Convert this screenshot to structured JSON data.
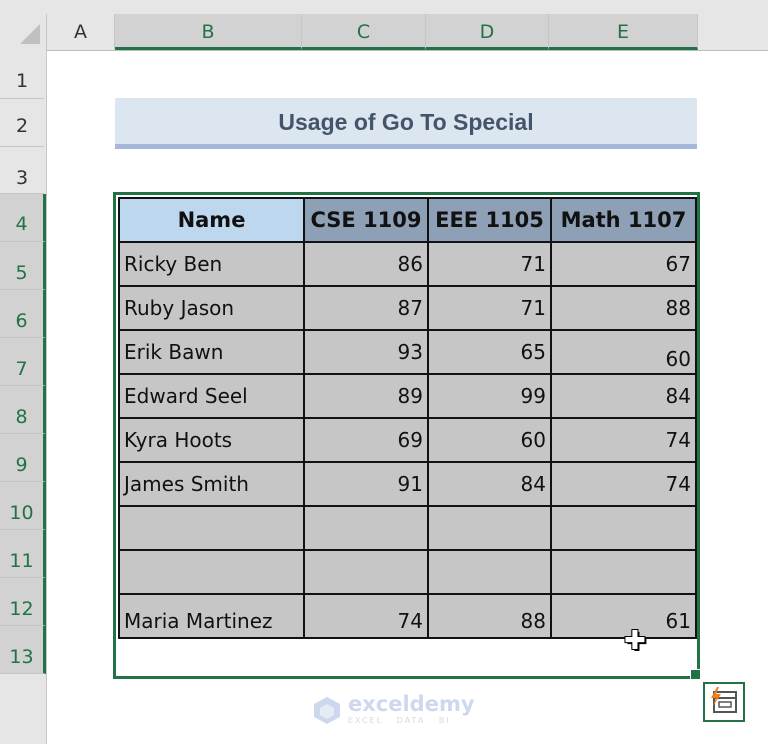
{
  "sheet": {
    "columns": [
      "A",
      "B",
      "C",
      "D",
      "E"
    ],
    "selected_columns": [
      "B",
      "C",
      "D",
      "E"
    ],
    "rows": [
      "1",
      "2",
      "3",
      "4",
      "5",
      "6",
      "7",
      "8",
      "9",
      "10",
      "11",
      "12",
      "13"
    ],
    "selected_rows": [
      "4",
      "5",
      "6",
      "7",
      "8",
      "9",
      "10",
      "11",
      "12",
      "13"
    ]
  },
  "title": "Usage of Go To Special",
  "table": {
    "headers": [
      "Name",
      "CSE 1109",
      "EEE 1105",
      "Math 1107"
    ],
    "rows": [
      [
        "Ricky Ben",
        "86",
        "71",
        "67"
      ],
      [
        "Ruby Jason",
        "87",
        "71",
        "88"
      ],
      [
        "Erik Bawn",
        "93",
        "65",
        "60"
      ],
      [
        "Edward Seel",
        "89",
        "99",
        "84"
      ],
      [
        "Kyra Hoots",
        "69",
        "60",
        "74"
      ],
      [
        "James Smith",
        "91",
        "84",
        "74"
      ],
      [
        "",
        "",
        "",
        ""
      ],
      [
        "",
        "",
        "",
        ""
      ],
      [
        "Maria Martinez",
        "74",
        "88",
        "61"
      ]
    ]
  },
  "icons": {
    "quick_analysis": "quick-analysis-icon",
    "cursor": "plus-cursor-icon",
    "fill_handle": "fill-handle"
  },
  "watermark": {
    "name": "exceldemy",
    "tagline": "EXCEL · DATA · BI"
  },
  "colors": {
    "accent": "#217346",
    "title_bg": "#dce6f1",
    "header_bg": "#8ea0b5",
    "name_header_bg": "#bdd7ee",
    "cell_bg": "#c6c6c6"
  }
}
